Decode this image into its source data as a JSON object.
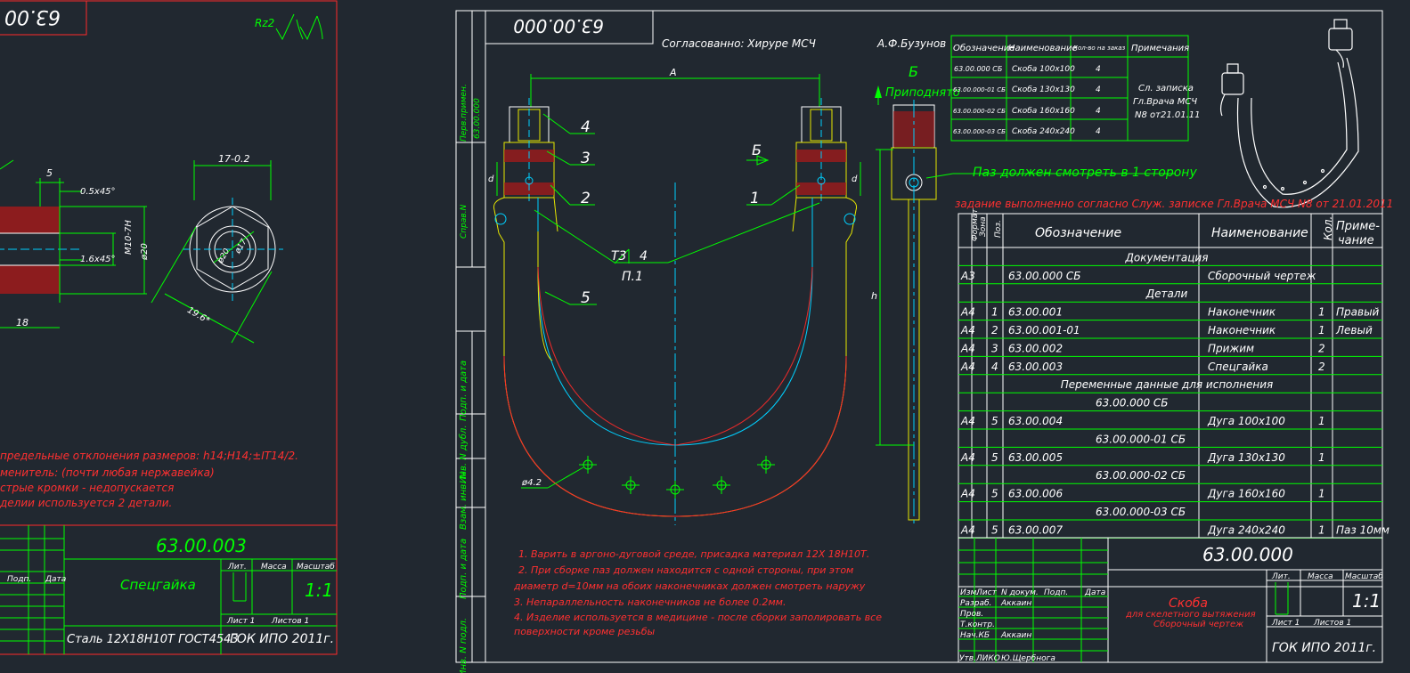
{
  "colors": {
    "bg": "#212830",
    "white": "#ffffff",
    "green": "#00ff00",
    "red": "#ff2a2a",
    "yellow": "#e8e800",
    "cyan": "#00d0ff"
  },
  "left_sheet": {
    "title_stamp": "63.00",
    "roughness": "Rz2",
    "dims": {
      "w17": "17-0.2",
      "d5": "5",
      "ch05": "0.5x45°",
      "ch16": "1.6x45°",
      "m10": "M10-7H",
      "d20": "ø20",
      "l18": "18",
      "s196": "19.6*",
      "c20": "ø20",
      "c17": "ø17"
    },
    "notes": [
      "предельные отклонения размеров: h14;H14;±IT14/2.",
      "менитель: (почти любая нержавейка)",
      "стрые кромки - недопускается",
      "делии используется 2 детали."
    ],
    "tb": {
      "code": "63.00.003",
      "name": "Спецгайка",
      "lit": "Лит.",
      "mass": "Масса",
      "scale_h": "Масштаб",
      "scale": "1:1",
      "sheet": "Лист 1",
      "sheets": "Листов 1",
      "material": "Сталь 12Х18Н10Т ГОСТ4543",
      "org": "ГОК ИПО 2011г.",
      "podp": "Подп.",
      "data": "Дата"
    }
  },
  "main": {
    "stamp": "63.00.000",
    "approved": "Согласованно: Хируре МСЧ",
    "author": "А.Ф.Бузунов",
    "view_b": "Б",
    "view_b2": "Б",
    "raised": "Приподнято",
    "paz": "Паз должен смотреть в 1 сторону",
    "dims": {
      "a": "A",
      "d1": "d",
      "d2": "d",
      "h": "h",
      "hole": "ø4.2",
      "t3": "Т3",
      "t3n": "4",
      "p1": "П.1"
    },
    "callouts": [
      "4",
      "3",
      "2",
      "1",
      "5"
    ],
    "side": {
      "perv": "Перв.примен.",
      "perv_v": "63.00.000",
      "sprav": "Справ.N",
      "podp1": "Подп. и дата",
      "inv1": "Инв. N дубл.",
      "vzam": "Взам. инв. N",
      "podp2": "Подп. и дата",
      "inv2": "Инв. N подл."
    },
    "notes": [
      "1. Варить в аргоно-дуговой среде, присадка материал 12Х 18Н10Т.",
      "2. При сборке паз должен находится с одной стороны, при этом",
      "диаметр d=10мм на обоих наконечниках должен смотреть наружу",
      "3. Непараллельность наконечников не более 0.2мм.",
      "4. Изделие используется в медицине - после сборки заполировать все",
      "поверхности кроме резьбы"
    ],
    "variants": {
      "headers": [
        "Обозначение",
        "Наименование",
        "Кол-во на заказ",
        "Примечания"
      ],
      "rows": [
        [
          "63.00.000 СБ",
          "Скоба 100х100",
          "4"
        ],
        [
          "63.00.000-01 СБ",
          "Скоба 130х130",
          "4"
        ],
        [
          "63.00.000-02 СБ",
          "Скоба 160х160",
          "4"
        ],
        [
          "63.00.000-03 СБ",
          "Скоба 240х240",
          "4"
        ]
      ],
      "note": [
        "Сл. записка",
        "Гл.Врача МСЧ",
        "N8 от21.01.11"
      ]
    },
    "zadanie": "задание выполненно согласно Служ. записке Гл.Врача МСЧ N8 от 21.01.2011",
    "spec": {
      "headers": [
        "Формат",
        "Зона",
        "Поз.",
        "Обозначение",
        "Наименование",
        "Кол.",
        "Приме-чание"
      ],
      "rows": [
        [
          "",
          "",
          "",
          "",
          "Документация",
          "",
          ""
        ],
        [
          "А3",
          "",
          "",
          "63.00.000 СБ",
          "Сборочный чертеж",
          "",
          ""
        ],
        [
          "",
          "",
          "",
          "",
          "Детали",
          "",
          ""
        ],
        [
          "А4",
          "",
          "1",
          "63.00.001",
          "Наконечник",
          "1",
          "Правый"
        ],
        [
          "А4",
          "",
          "2",
          "63.00.001-01",
          "Наконечник",
          "1",
          "Левый"
        ],
        [
          "А4",
          "",
          "3",
          "63.00.002",
          "Прижим",
          "2",
          ""
        ],
        [
          "А4",
          "",
          "4",
          "63.00.003",
          "Спецгайка",
          "2",
          ""
        ],
        [
          "",
          "",
          "",
          "",
          "Переменные данные для исполнения",
          "",
          ""
        ],
        [
          "",
          "",
          "",
          "63.00.000 СБ",
          "",
          "",
          ""
        ],
        [
          "А4",
          "",
          "5",
          "63.00.004",
          "Дуга 100х100",
          "1",
          ""
        ],
        [
          "",
          "",
          "",
          "63.00.000-01 СБ",
          "",
          "",
          ""
        ],
        [
          "А4",
          "",
          "5",
          "63.00.005",
          "Дуга 130х130",
          "1",
          ""
        ],
        [
          "",
          "",
          "",
          "63.00.000-02 СБ",
          "",
          "",
          ""
        ],
        [
          "А4",
          "",
          "5",
          "63.00.006",
          "Дуга 160х160",
          "1",
          ""
        ],
        [
          "",
          "",
          "",
          "63.00.000-03 СБ",
          "",
          "",
          ""
        ],
        [
          "А4",
          "",
          "5",
          "63.00.007",
          "Дуга 240х240",
          "1",
          "Паз 10мм"
        ]
      ]
    },
    "tb": {
      "code": "63.00.000",
      "name1": "Скоба",
      "name2": "для скелетного вытяжения",
      "name3": "Сборочный чертеж",
      "lit": "Лит.",
      "mass": "Масса",
      "scale_h": "Масштаб",
      "scale": "1:1",
      "sheet": "Лист 1",
      "sheets": "Листов 1",
      "org": "ГОК ИПО 2011г.",
      "izm": "Изм.",
      "list": "Лист",
      "ndok": "N докум.",
      "podp": "Подп.",
      "data": "Дата",
      "razrab": "Разраб.",
      "razrab_n": "Аккаин",
      "prov": "Пров.",
      "tkontr": "Т.контр.",
      "nach": "Нач.КБ",
      "nach_n": "Аккаин",
      "utv": "Утв.ЛИКО",
      "utv_n": "Ю.Щербнога"
    }
  }
}
